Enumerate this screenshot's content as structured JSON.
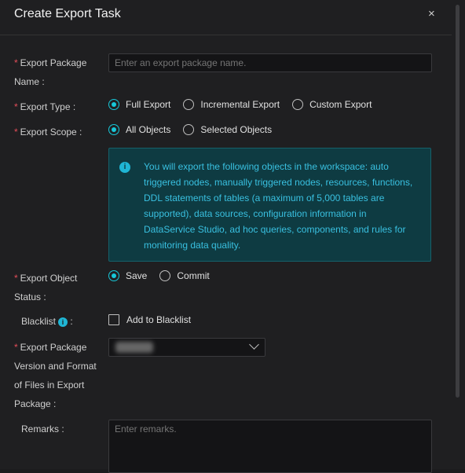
{
  "dialog": {
    "title": "Create Export Task",
    "close_symbol": "×"
  },
  "form": {
    "package_name": {
      "label_line1": "Export Package",
      "label_line2": "Name :",
      "placeholder": "Enter an export package name."
    },
    "export_type": {
      "label": "Export Type :",
      "options": [
        "Full Export",
        "Incremental Export",
        "Custom Export"
      ],
      "selected": "Full Export"
    },
    "export_scope": {
      "label": "Export Scope :",
      "options": [
        "All Objects",
        "Selected Objects"
      ],
      "selected": "All Objects"
    },
    "info": {
      "icon": "i",
      "text": "You will export the following objects in the workspace: auto triggered nodes, manually triggered nodes, resources, functions, DDL statements of tables (a maximum of 5,000 tables are supported), data sources, configuration information in DataService Studio, ad hoc queries, components, and rules for monitoring data quality."
    },
    "object_status": {
      "label_line1": "Export Object",
      "label_line2": "Status :",
      "options": [
        "Save",
        "Commit"
      ],
      "selected": "Save"
    },
    "blacklist": {
      "label": "Blacklist",
      "colon": ":",
      "tip_icon": "i",
      "checkbox_label": "Add to Blacklist",
      "checked": false
    },
    "version": {
      "label_lines": [
        "Export Package",
        "Version and Format",
        "of Files in Export",
        "Package :"
      ]
    },
    "remarks": {
      "label": "Remarks :",
      "placeholder": "Enter remarks."
    }
  },
  "colors": {
    "accent": "#17c7d8",
    "required": "#e34d59",
    "info_bg": "#0e3b42",
    "info_text": "#39c0e0"
  }
}
